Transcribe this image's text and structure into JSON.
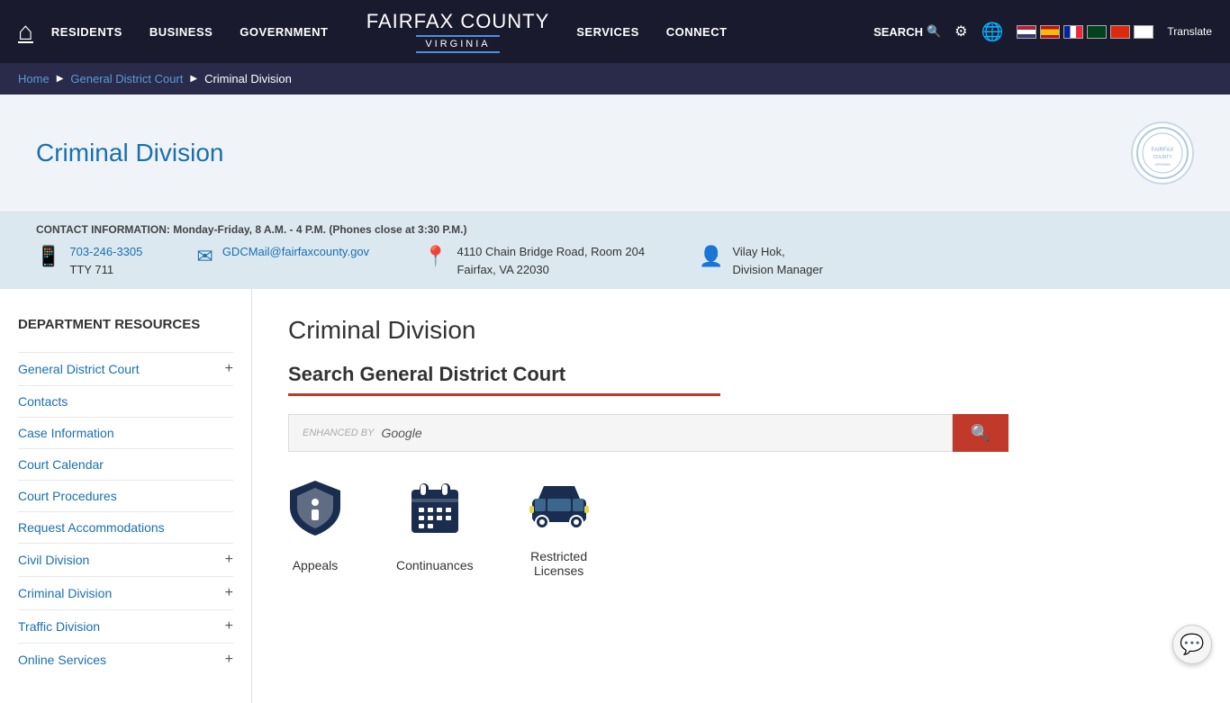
{
  "nav": {
    "home_icon": "⌂",
    "links": [
      "RESIDENTS",
      "BUSINESS",
      "GOVERNMENT",
      "SERVICES",
      "CONNECT"
    ],
    "search_label": "SEARCH",
    "translate_label": "Translate",
    "logo_fairfax": "FAIRFAX",
    "logo_county": "COUNTY",
    "logo_virginia": "VIRGINIA"
  },
  "breadcrumb": {
    "home": "Home",
    "parent": "General District Court",
    "current": "Criminal Division"
  },
  "page_header": {
    "title": "Criminal Division"
  },
  "contact": {
    "label": "CONTACT INFORMATION: Monday-Friday, 8 A.M. - 4 P.M. (Phones close at 3:30 P.M.)",
    "phone": "703-246-3305",
    "tty": "TTY 711",
    "email": "GDCMail@fairfaxcounty.gov",
    "address_line1": "4110 Chain Bridge Road, Room 204",
    "address_line2": "Fairfax, VA 22030",
    "manager_name": "Vilay Hok,",
    "manager_title": "Division Manager"
  },
  "sidebar": {
    "dept_title": "DEPARTMENT RESOURCES",
    "items": [
      {
        "label": "General District Court",
        "has_plus": true
      },
      {
        "label": "Contacts",
        "has_plus": false
      },
      {
        "label": "Case Information",
        "has_plus": false
      },
      {
        "label": "Court Calendar",
        "has_plus": false
      },
      {
        "label": "Court Procedures",
        "has_plus": false
      },
      {
        "label": "Request Accommodations",
        "has_plus": false
      },
      {
        "label": "Civil Division",
        "has_plus": true
      },
      {
        "label": "Criminal Division",
        "has_plus": true
      },
      {
        "label": "Traffic Division",
        "has_plus": true
      },
      {
        "label": "Online Services",
        "has_plus": true
      }
    ]
  },
  "content": {
    "title": "Criminal Division",
    "search_heading": "Search General District Court",
    "search_placeholder": "ENHANCED BY Google",
    "features": [
      {
        "label": "Appeals",
        "icon": "shield"
      },
      {
        "label": "Continuances",
        "icon": "calendar"
      },
      {
        "label": "Restricted\nLicenses",
        "icon": "car"
      }
    ]
  },
  "chat": {
    "icon": "💬"
  }
}
